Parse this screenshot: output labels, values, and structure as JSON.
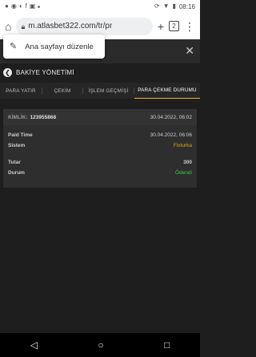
{
  "status_bar": {
    "time": "08:16"
  },
  "browser": {
    "url": "m.atlasbet322.com/tr/pr",
    "tab_count": "2"
  },
  "popup": {
    "text": "Ana sayfayı düzenle"
  },
  "panel": {
    "title": "BAKİYE YÖNETİMİ"
  },
  "tabs": [
    {
      "label": "PARA YATIR"
    },
    {
      "label": "ÇEKİM"
    },
    {
      "label": "İŞLEM GEÇMİŞİ"
    },
    {
      "label": "PARA ÇEKME DURUMU"
    }
  ],
  "transaction": {
    "kimlik_label": "KİMLİK:",
    "kimlik_value": "123955868",
    "created": "30.04.2022, 06:02",
    "paid_time_label": "Paid Time",
    "paid_time_value": "30.04.2022, 06:06",
    "system_label": "Sistem",
    "system_value": "Fixturka",
    "amount_label": "Tutar",
    "amount_value": "300",
    "status_label": "Durum",
    "status_value": "Ödendi"
  },
  "colors": {
    "system_value": "#e8a317",
    "status_value": "#2ecc40",
    "active_tab_underline": "#f0b429"
  }
}
